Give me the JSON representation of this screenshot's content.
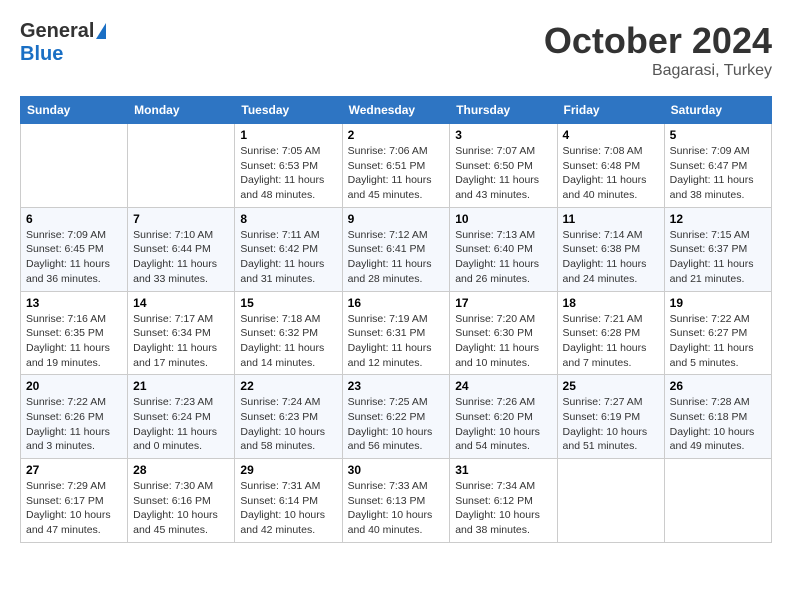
{
  "header": {
    "logo_general": "General",
    "logo_blue": "Blue",
    "month_title": "October 2024",
    "location": "Bagarasi, Turkey"
  },
  "days_of_week": [
    "Sunday",
    "Monday",
    "Tuesday",
    "Wednesday",
    "Thursday",
    "Friday",
    "Saturday"
  ],
  "weeks": [
    [
      {
        "day": "",
        "sunrise": "",
        "sunset": "",
        "daylight": ""
      },
      {
        "day": "",
        "sunrise": "",
        "sunset": "",
        "daylight": ""
      },
      {
        "day": "1",
        "sunrise": "Sunrise: 7:05 AM",
        "sunset": "Sunset: 6:53 PM",
        "daylight": "Daylight: 11 hours and 48 minutes."
      },
      {
        "day": "2",
        "sunrise": "Sunrise: 7:06 AM",
        "sunset": "Sunset: 6:51 PM",
        "daylight": "Daylight: 11 hours and 45 minutes."
      },
      {
        "day": "3",
        "sunrise": "Sunrise: 7:07 AM",
        "sunset": "Sunset: 6:50 PM",
        "daylight": "Daylight: 11 hours and 43 minutes."
      },
      {
        "day": "4",
        "sunrise": "Sunrise: 7:08 AM",
        "sunset": "Sunset: 6:48 PM",
        "daylight": "Daylight: 11 hours and 40 minutes."
      },
      {
        "day": "5",
        "sunrise": "Sunrise: 7:09 AM",
        "sunset": "Sunset: 6:47 PM",
        "daylight": "Daylight: 11 hours and 38 minutes."
      }
    ],
    [
      {
        "day": "6",
        "sunrise": "Sunrise: 7:09 AM",
        "sunset": "Sunset: 6:45 PM",
        "daylight": "Daylight: 11 hours and 36 minutes."
      },
      {
        "day": "7",
        "sunrise": "Sunrise: 7:10 AM",
        "sunset": "Sunset: 6:44 PM",
        "daylight": "Daylight: 11 hours and 33 minutes."
      },
      {
        "day": "8",
        "sunrise": "Sunrise: 7:11 AM",
        "sunset": "Sunset: 6:42 PM",
        "daylight": "Daylight: 11 hours and 31 minutes."
      },
      {
        "day": "9",
        "sunrise": "Sunrise: 7:12 AM",
        "sunset": "Sunset: 6:41 PM",
        "daylight": "Daylight: 11 hours and 28 minutes."
      },
      {
        "day": "10",
        "sunrise": "Sunrise: 7:13 AM",
        "sunset": "Sunset: 6:40 PM",
        "daylight": "Daylight: 11 hours and 26 minutes."
      },
      {
        "day": "11",
        "sunrise": "Sunrise: 7:14 AM",
        "sunset": "Sunset: 6:38 PM",
        "daylight": "Daylight: 11 hours and 24 minutes."
      },
      {
        "day": "12",
        "sunrise": "Sunrise: 7:15 AM",
        "sunset": "Sunset: 6:37 PM",
        "daylight": "Daylight: 11 hours and 21 minutes."
      }
    ],
    [
      {
        "day": "13",
        "sunrise": "Sunrise: 7:16 AM",
        "sunset": "Sunset: 6:35 PM",
        "daylight": "Daylight: 11 hours and 19 minutes."
      },
      {
        "day": "14",
        "sunrise": "Sunrise: 7:17 AM",
        "sunset": "Sunset: 6:34 PM",
        "daylight": "Daylight: 11 hours and 17 minutes."
      },
      {
        "day": "15",
        "sunrise": "Sunrise: 7:18 AM",
        "sunset": "Sunset: 6:32 PM",
        "daylight": "Daylight: 11 hours and 14 minutes."
      },
      {
        "day": "16",
        "sunrise": "Sunrise: 7:19 AM",
        "sunset": "Sunset: 6:31 PM",
        "daylight": "Daylight: 11 hours and 12 minutes."
      },
      {
        "day": "17",
        "sunrise": "Sunrise: 7:20 AM",
        "sunset": "Sunset: 6:30 PM",
        "daylight": "Daylight: 11 hours and 10 minutes."
      },
      {
        "day": "18",
        "sunrise": "Sunrise: 7:21 AM",
        "sunset": "Sunset: 6:28 PM",
        "daylight": "Daylight: 11 hours and 7 minutes."
      },
      {
        "day": "19",
        "sunrise": "Sunrise: 7:22 AM",
        "sunset": "Sunset: 6:27 PM",
        "daylight": "Daylight: 11 hours and 5 minutes."
      }
    ],
    [
      {
        "day": "20",
        "sunrise": "Sunrise: 7:22 AM",
        "sunset": "Sunset: 6:26 PM",
        "daylight": "Daylight: 11 hours and 3 minutes."
      },
      {
        "day": "21",
        "sunrise": "Sunrise: 7:23 AM",
        "sunset": "Sunset: 6:24 PM",
        "daylight": "Daylight: 11 hours and 0 minutes."
      },
      {
        "day": "22",
        "sunrise": "Sunrise: 7:24 AM",
        "sunset": "Sunset: 6:23 PM",
        "daylight": "Daylight: 10 hours and 58 minutes."
      },
      {
        "day": "23",
        "sunrise": "Sunrise: 7:25 AM",
        "sunset": "Sunset: 6:22 PM",
        "daylight": "Daylight: 10 hours and 56 minutes."
      },
      {
        "day": "24",
        "sunrise": "Sunrise: 7:26 AM",
        "sunset": "Sunset: 6:20 PM",
        "daylight": "Daylight: 10 hours and 54 minutes."
      },
      {
        "day": "25",
        "sunrise": "Sunrise: 7:27 AM",
        "sunset": "Sunset: 6:19 PM",
        "daylight": "Daylight: 10 hours and 51 minutes."
      },
      {
        "day": "26",
        "sunrise": "Sunrise: 7:28 AM",
        "sunset": "Sunset: 6:18 PM",
        "daylight": "Daylight: 10 hours and 49 minutes."
      }
    ],
    [
      {
        "day": "27",
        "sunrise": "Sunrise: 7:29 AM",
        "sunset": "Sunset: 6:17 PM",
        "daylight": "Daylight: 10 hours and 47 minutes."
      },
      {
        "day": "28",
        "sunrise": "Sunrise: 7:30 AM",
        "sunset": "Sunset: 6:16 PM",
        "daylight": "Daylight: 10 hours and 45 minutes."
      },
      {
        "day": "29",
        "sunrise": "Sunrise: 7:31 AM",
        "sunset": "Sunset: 6:14 PM",
        "daylight": "Daylight: 10 hours and 42 minutes."
      },
      {
        "day": "30",
        "sunrise": "Sunrise: 7:33 AM",
        "sunset": "Sunset: 6:13 PM",
        "daylight": "Daylight: 10 hours and 40 minutes."
      },
      {
        "day": "31",
        "sunrise": "Sunrise: 7:34 AM",
        "sunset": "Sunset: 6:12 PM",
        "daylight": "Daylight: 10 hours and 38 minutes."
      },
      {
        "day": "",
        "sunrise": "",
        "sunset": "",
        "daylight": ""
      },
      {
        "day": "",
        "sunrise": "",
        "sunset": "",
        "daylight": ""
      }
    ]
  ]
}
